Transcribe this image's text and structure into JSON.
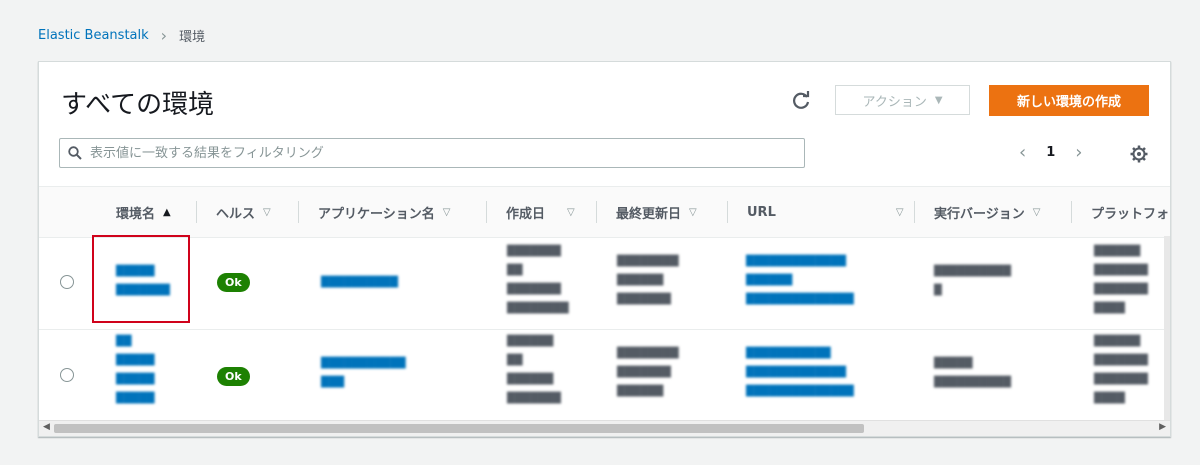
{
  "breadcrumb": {
    "parent": "Elastic Beanstalk",
    "current": "環境"
  },
  "page": {
    "title": "すべての環境"
  },
  "toolbar": {
    "actions_label": "アクション",
    "create_label": "新しい環境の作成"
  },
  "filter": {
    "placeholder": "表示値に一致する結果をフィルタリング",
    "value": ""
  },
  "pagination": {
    "current_page": "1"
  },
  "table": {
    "columns": {
      "env_name": "環境名",
      "health": "ヘルス",
      "app_name": "アプリケーション名",
      "created": "作成日",
      "updated": "最終更新日",
      "url": "URL",
      "running_version": "実行バージョン",
      "platform": "プラットフォ"
    },
    "rows": [
      {
        "env_name": "█████\n███████",
        "health": "Ok",
        "app_name": "██████████",
        "created": "███████\n██\n███████\n████████",
        "updated": "████████\n██████\n███████",
        "url": "█████████████\n██████\n██████████████",
        "running_version": "██████████\n█",
        "platform": "██████\n███████\n███████\n████"
      },
      {
        "env_name": "██\n█████\n█████\n█████",
        "health": "Ok",
        "app_name": "███████████\n███",
        "created": "██████\n██\n██████\n███████",
        "updated": "████████\n███████\n██████",
        "url": "███████████\n█████████████\n██████████████",
        "running_version": "█████\n██████████",
        "platform": "██████\n███████\n███████\n████"
      }
    ]
  },
  "icons": {
    "refresh": "refresh-icon",
    "search": "search-icon",
    "settings": "gear-icon",
    "sort_asc": "triangle-up-icon",
    "sort": "triangle-down-icon"
  },
  "colors": {
    "primary_button": "#ec7211",
    "link": "#0073bb",
    "health_ok": "#1d8102",
    "highlight": "#d0021b"
  }
}
